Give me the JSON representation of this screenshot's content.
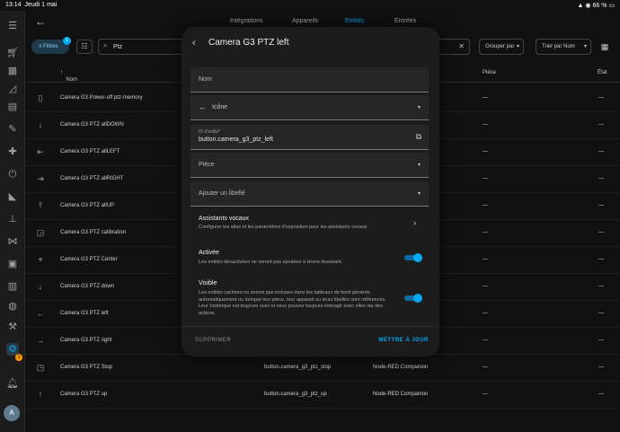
{
  "status_bar": {
    "time": "13:14",
    "date": "Jeudi 1 mai",
    "battery": "66 %"
  },
  "sidebar": {
    "icons": [
      "menu-icon",
      "cart-icon",
      "calendar-icon",
      "chart-icon",
      "server-icon",
      "wrench-icon",
      "puzzle-icon",
      "power-plug-icon",
      "cctv-icon",
      "sitemap-icon",
      "vscode-icon",
      "terminal-icon",
      "clipboard-icon",
      "compass-icon",
      "hammer-icon",
      "settings-icon",
      "bell-icon"
    ],
    "settings_badge": "1",
    "avatar": "A"
  },
  "topbar": {
    "tabs": [
      {
        "label": "Intégrations"
      },
      {
        "label": "Appareils"
      },
      {
        "label": "Entités"
      },
      {
        "label": "Entrées"
      }
    ]
  },
  "toolbar": {
    "filters_label": "Filtres",
    "filters_count": "1",
    "search_value": "Ptz",
    "group_by_label": "Grouper par",
    "sort_by_label": "Trier par Nom"
  },
  "table": {
    "headers": {
      "name": "Nom",
      "room": "Pièce",
      "state": "État"
    },
    "rows": [
      {
        "icon": "remote-icon",
        "name": "Camera G3 Power-off ptz-memory",
        "entity_id": "",
        "integration": "",
        "room": "—",
        "state": "—"
      },
      {
        "icon": "arrow-down-icon",
        "name": "Camera G3 PTZ allDOWN",
        "entity_id": "",
        "integration": "",
        "room": "—",
        "state": "—"
      },
      {
        "icon": "arrow-left-bar-icon",
        "name": "Camera G3 PTZ allLEFT",
        "entity_id": "",
        "integration": "",
        "room": "—",
        "state": "—"
      },
      {
        "icon": "arrow-right-bar-icon",
        "name": "Camera G3 PTZ allRIGHT",
        "entity_id": "",
        "integration": "",
        "room": "—",
        "state": "—"
      },
      {
        "icon": "arrow-up-bar-icon",
        "name": "Camera G3 PTZ allUP",
        "entity_id": "",
        "integration": "",
        "room": "—",
        "state": "—"
      },
      {
        "icon": "calibrate-icon",
        "name": "Camera G3 PTZ calibration",
        "entity_id": "",
        "integration": "",
        "room": "—",
        "state": "—"
      },
      {
        "icon": "center-icon",
        "name": "Camera G3 PTZ Center",
        "entity_id": "",
        "integration": "",
        "room": "—",
        "state": "—"
      },
      {
        "icon": "arrow-down-icon",
        "name": "Camera G3 PTZ down",
        "entity_id": "",
        "integration": "",
        "room": "—",
        "state": "—"
      },
      {
        "icon": "arrow-left-icon",
        "name": "Camera G3 PTZ left",
        "entity_id": "",
        "integration": "",
        "room": "—",
        "state": "—"
      },
      {
        "icon": "arrow-right-icon",
        "name": "Camera G3 PTZ right",
        "entity_id": "",
        "integration": "",
        "room": "—",
        "state": "—"
      },
      {
        "icon": "stop-icon",
        "name": "Camera G3 PTZ Stop",
        "entity_id": "button.camera_g3_ptz_stop",
        "integration": "Node-RED Companion",
        "room": "—",
        "state": "—"
      },
      {
        "icon": "arrow-up-icon",
        "name": "Camera G3 PTZ up",
        "entity_id": "button.camera_g3_ptz_up",
        "integration": "Node-RED Companion",
        "room": "—",
        "state": "—"
      }
    ]
  },
  "dialog": {
    "title": "Camera G3 PTZ left",
    "name_label": "Nom",
    "icon_label": "Icône",
    "entity_id_label": "ID d'entité*",
    "entity_id_value": "button.camera_g3_ptz_left",
    "room_label": "Pièce",
    "add_label_label": "Ajouter un libellé",
    "voice_title": "Assistants vocaux",
    "voice_desc": "Configurer les alias et les paramètres d'exposition pour les assistants vocaux",
    "enabled_title": "Activée",
    "enabled_desc": "Les entités désactivées ne seront pas ajoutées à Home Assistant.",
    "enabled_on": true,
    "visible_title": "Visible",
    "visible_desc": "Les entités cachées ne seront pas incluses dans les tableaux de bord générés automatiquement ou lorsque leur pièce, leur appareil ou leurs libellés sont référencés. Leur historique est toujours suivi et vous pouvez toujours interagir avec elles via des actions.",
    "visible_on": true,
    "delete_label": "SUPPRIMER",
    "update_label": "METTRE À JOUR"
  },
  "colors": {
    "accent": "#03a9f4",
    "background": "#111111",
    "dialog": "#1c1c1c",
    "badge": "#ff9800"
  }
}
